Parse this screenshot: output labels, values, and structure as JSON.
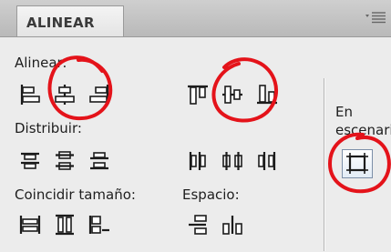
{
  "panel": {
    "tab_title": "ALINEAR",
    "menu_icon": "panel-menu-icon"
  },
  "sections": {
    "align": "Alinear:",
    "distribute": "Distribuir:",
    "match_size": "Coincidir tamaño:",
    "space": "Espacio:",
    "stage_line1": "En",
    "stage_line2": "escenario"
  },
  "icons": {
    "align": [
      "align-left-icon",
      "align-horizontal-center-icon",
      "align-right-icon",
      "align-top-icon",
      "align-vertical-center-icon",
      "align-bottom-icon"
    ],
    "distribute": [
      "distribute-top-icon",
      "distribute-vertical-center-icon",
      "distribute-bottom-icon",
      "distribute-left-icon",
      "distribute-horizontal-center-icon",
      "distribute-right-icon"
    ],
    "match_size": [
      "match-width-icon",
      "match-height-icon",
      "match-width-and-height-icon"
    ],
    "space": [
      "space-evenly-vertically-icon",
      "space-evenly-horizontally-icon"
    ],
    "stage": "align-to-stage-icon"
  },
  "annotation_color": "#e4131a"
}
